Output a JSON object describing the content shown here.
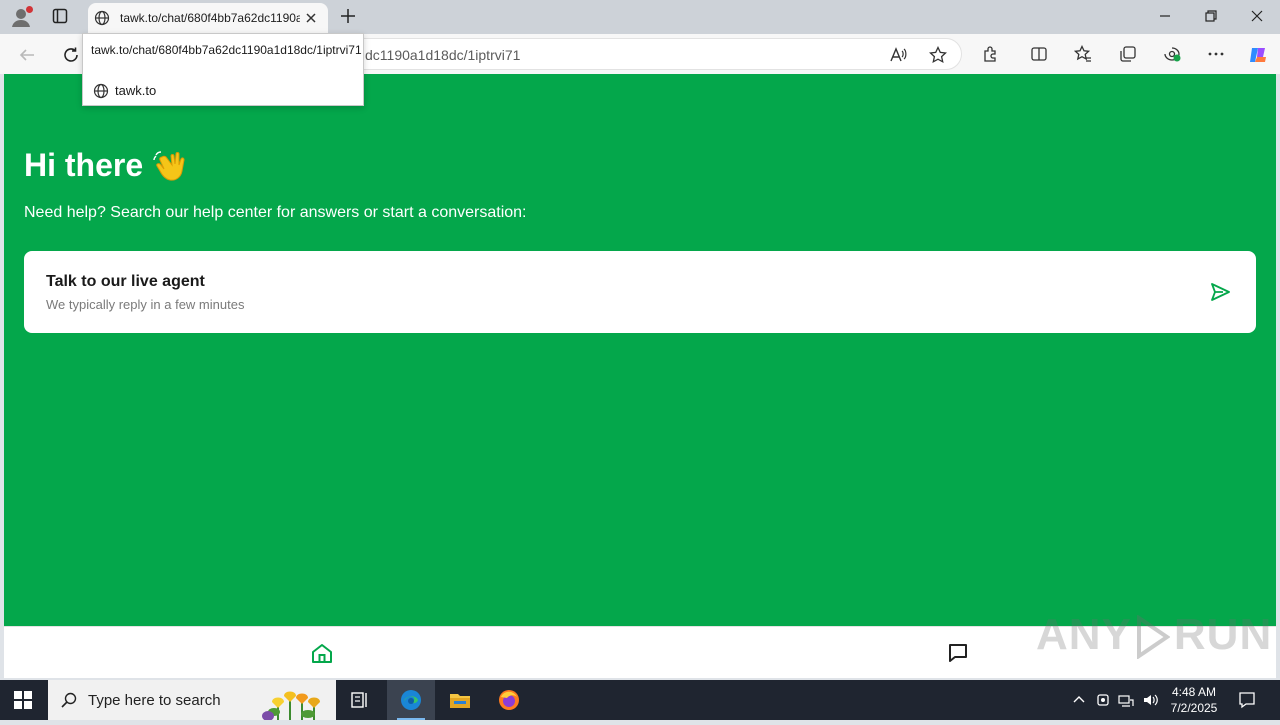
{
  "browser": {
    "tab_title": "tawk.to/chat/680f4bb7a62dc1190a1d18dc/1iptrvi71",
    "address_visible": "dc1190a1d18dc/1iptrvi71",
    "tooltip_url": "tawk.to/chat/680f4bb7a62dc1190a1d18dc/1iptrvi71",
    "tooltip_site": "tawk.to"
  },
  "page": {
    "greeting": "Hi there",
    "subtitle": "Need help? Search our help center for answers or start a conversation:",
    "card_title": "Talk to our live agent",
    "card_subtitle": "We typically reply in a few minutes",
    "watermark_left": "ANY",
    "watermark_right": "RUN"
  },
  "taskbar": {
    "search_placeholder": "Type here to search",
    "time": "4:48 AM",
    "date": "7/2/2025"
  },
  "colors": {
    "accent": "#04a74b",
    "taskbar": "#1f2530"
  }
}
